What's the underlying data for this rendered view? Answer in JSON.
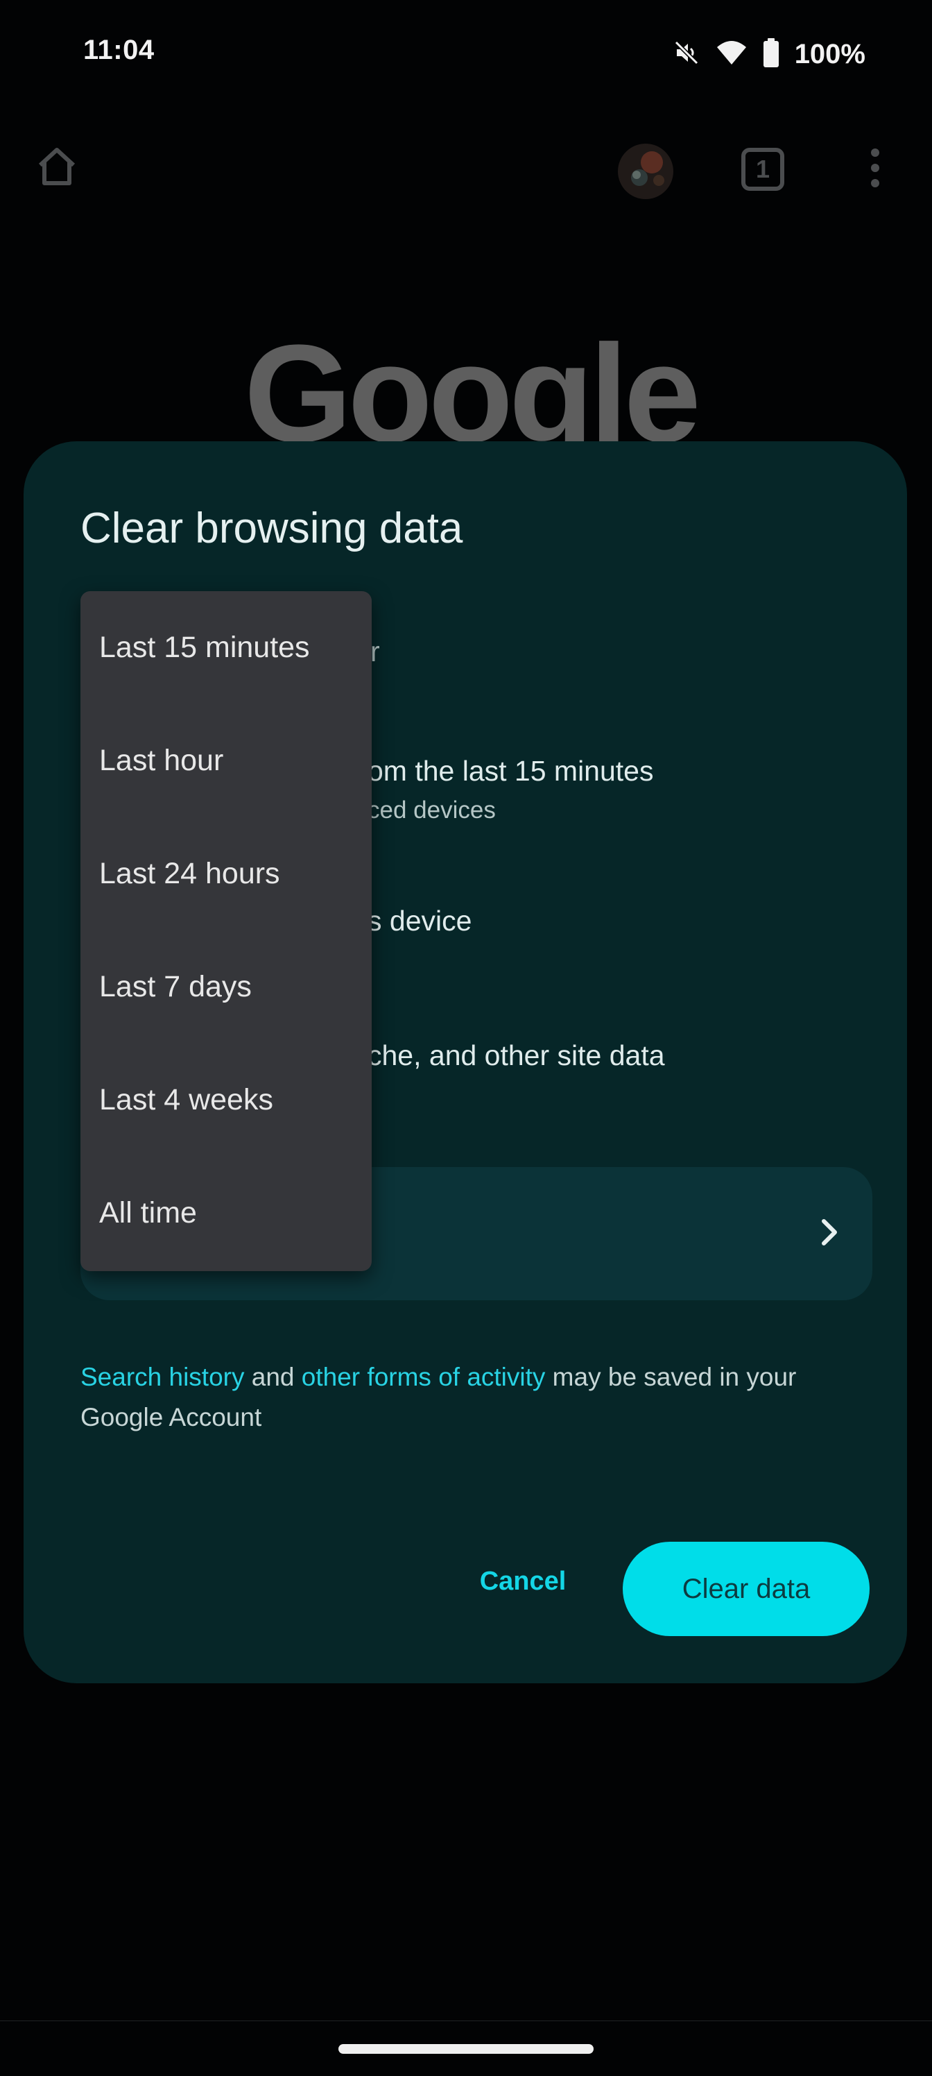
{
  "status_bar": {
    "time": "11:04",
    "battery": "100%",
    "icons": [
      "mute-icon",
      "wifi-icon",
      "battery-icon"
    ]
  },
  "toolbar": {
    "icons": [
      "home-icon",
      "avatar",
      "tab-count-icon",
      "more-vert-icon"
    ],
    "tab_count": "1"
  },
  "background": {
    "logo": "Google"
  },
  "dialog": {
    "title": "Clear browsing data",
    "time_range_label_partial": "r",
    "options": [
      {
        "title_partial": "om the last 15 minutes",
        "subtitle_partial": "ced devices"
      },
      {
        "title_partial": "s device"
      },
      {
        "title_partial": "che, and other site data"
      }
    ],
    "footer": {
      "link1": "Search history",
      "text1": " and ",
      "link2": "other forms of activity",
      "text2": " may be saved in your Google Account"
    },
    "cancel_label": "Cancel",
    "clear_label": "Clear data"
  },
  "time_range_menu": {
    "items": [
      {
        "label": "Last 15 minutes"
      },
      {
        "label": "Last hour"
      },
      {
        "label": "Last 24 hours"
      },
      {
        "label": "Last 7 days"
      },
      {
        "label": "Last 4 weeks"
      },
      {
        "label": "All time"
      }
    ]
  },
  "colors": {
    "dialog_bg": "#062628",
    "accent": "#00dde9",
    "link": "#29d3e4",
    "menu_bg": "#35363a"
  }
}
